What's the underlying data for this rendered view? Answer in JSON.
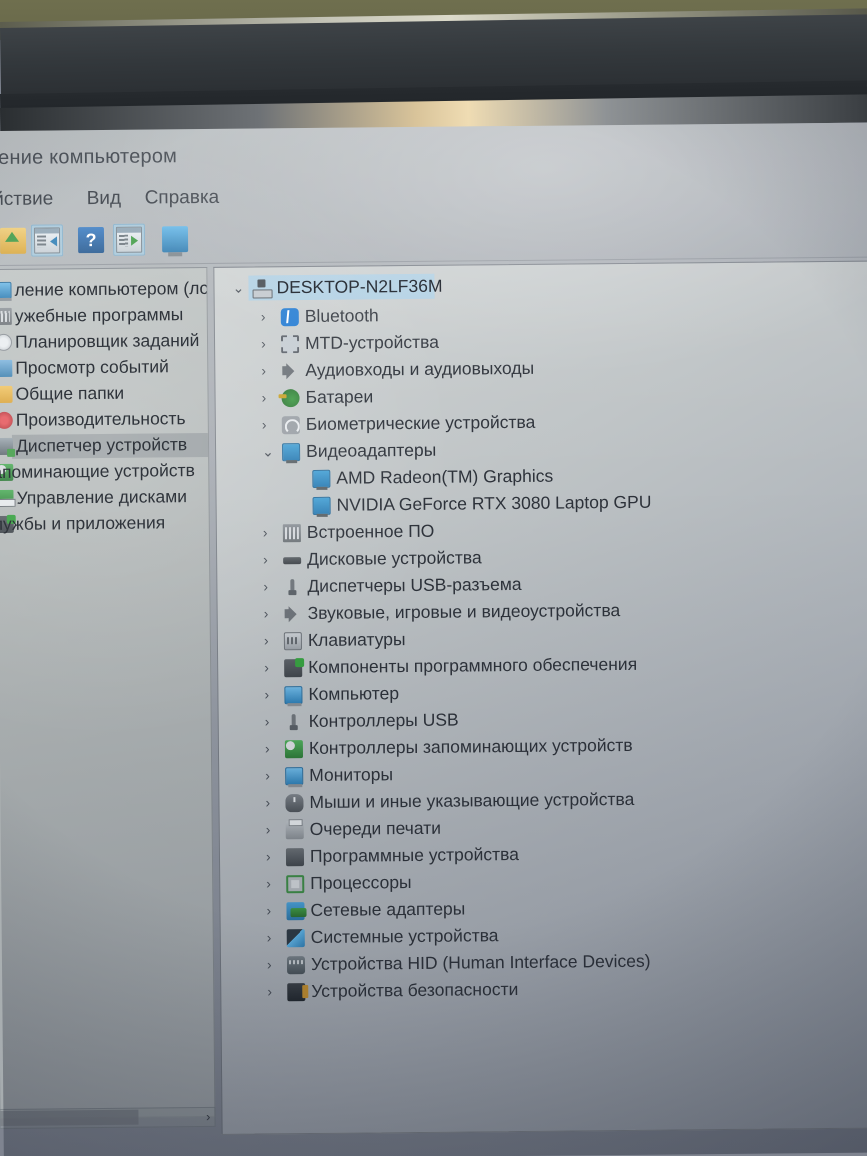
{
  "window": {
    "title": "ление компьютером",
    "title_full": "Управление компьютером"
  },
  "menubar": {
    "items": [
      {
        "label": "ействие",
        "name": "menu-action"
      },
      {
        "label": "Вид",
        "name": "menu-view"
      },
      {
        "label": "Справка",
        "name": "menu-help"
      }
    ]
  },
  "toolbar": {
    "buttons": [
      {
        "icon": "back-folder-icon",
        "selected": false
      },
      {
        "icon": "show-hide-console-tree-icon",
        "selected": true
      },
      {
        "icon": "help-icon",
        "selected": false
      },
      {
        "icon": "show-hide-action-pane-icon",
        "selected": true
      },
      {
        "icon": "computer-monitor-icon",
        "selected": false
      }
    ]
  },
  "sidebar": {
    "items": [
      {
        "label": "ление компьютером (лс",
        "icon": "computer-icon",
        "selected": false,
        "indent": 0
      },
      {
        "label": "ужебные программы",
        "icon": "tools-icon",
        "selected": false,
        "indent": 0
      },
      {
        "label": "Планировщик заданий",
        "icon": "clock-icon",
        "selected": false,
        "indent": 1
      },
      {
        "label": "Просмотр событий",
        "icon": "event-viewer-icon",
        "selected": false,
        "indent": 1
      },
      {
        "label": "Общие папки",
        "icon": "folder-icon",
        "selected": false,
        "indent": 1
      },
      {
        "label": "Производительность",
        "icon": "performance-icon",
        "selected": false,
        "indent": 1
      },
      {
        "label": "Диспетчер устройств",
        "icon": "device-manager-icon",
        "selected": true,
        "indent": 1
      },
      {
        "label": "апоминающие устройств",
        "icon": "storage-icon",
        "selected": false,
        "indent": 0
      },
      {
        "label": "Управление дисками",
        "icon": "disk-management-icon",
        "selected": false,
        "indent": 1
      },
      {
        "label": "лужбы и приложения",
        "icon": "services-icon",
        "selected": false,
        "indent": 0
      }
    ]
  },
  "device_tree": {
    "root": {
      "label": "DESKTOP-N2LF36M",
      "icon": "computer-host-icon",
      "expanded": true,
      "selected": true
    },
    "nodes": [
      {
        "label": "Bluetooth",
        "icon": "bluetooth-icon",
        "iconclass": "ic-bt",
        "depth": 1,
        "expanded": false
      },
      {
        "label": "MTD-устройства",
        "icon": "mtd-device-icon",
        "iconclass": "ic-mtd",
        "depth": 1,
        "expanded": false
      },
      {
        "label": "Аудиовходы и аудиовыходы",
        "icon": "speaker-icon",
        "iconclass": "ic-spk",
        "depth": 1,
        "expanded": false
      },
      {
        "label": "Батареи",
        "icon": "battery-icon",
        "iconclass": "ic-bat",
        "depth": 1,
        "expanded": false
      },
      {
        "label": "Биометрические устройства",
        "icon": "fingerprint-icon",
        "iconclass": "ic-bio",
        "depth": 1,
        "expanded": false
      },
      {
        "label": "Видеоадаптеры",
        "icon": "display-adapter-icon",
        "iconclass": "ic-mon",
        "depth": 1,
        "expanded": true
      },
      {
        "label": "AMD Radeon(TM) Graphics",
        "icon": "display-adapter-icon",
        "iconclass": "ic-mon",
        "depth": 2,
        "expanded": null
      },
      {
        "label": "NVIDIA GeForce RTX 3080 Laptop GPU",
        "icon": "display-adapter-icon",
        "iconclass": "ic-mon",
        "depth": 2,
        "expanded": null
      },
      {
        "label": "Встроенное ПО",
        "icon": "firmware-icon",
        "iconclass": "ic-fw",
        "depth": 1,
        "expanded": false
      },
      {
        "label": "Дисковые устройства",
        "icon": "disk-drive-icon",
        "iconclass": "ic-disk",
        "depth": 1,
        "expanded": false
      },
      {
        "label": "Диспетчеры USB-разъема",
        "icon": "usb-connector-icon",
        "iconclass": "ic-usb",
        "depth": 1,
        "expanded": false
      },
      {
        "label": "Звуковые, игровые и видеоустройства",
        "icon": "speaker-icon",
        "iconclass": "ic-spk",
        "depth": 1,
        "expanded": false
      },
      {
        "label": "Клавиатуры",
        "icon": "keyboard-icon",
        "iconclass": "ic-kb",
        "depth": 1,
        "expanded": false
      },
      {
        "label": "Компоненты программного обеспечения",
        "icon": "software-component-icon",
        "iconclass": "ic-sw",
        "depth": 1,
        "expanded": false
      },
      {
        "label": "Компьютер",
        "icon": "computer-icon",
        "iconclass": "ic-pc",
        "depth": 1,
        "expanded": false
      },
      {
        "label": "Контроллеры USB",
        "icon": "usb-controller-icon",
        "iconclass": "ic-usb",
        "depth": 1,
        "expanded": false
      },
      {
        "label": "Контроллеры запоминающих устройств",
        "icon": "storage-controller-icon",
        "iconclass": "ic-store",
        "depth": 1,
        "expanded": false
      },
      {
        "label": "Мониторы",
        "icon": "monitor-icon",
        "iconclass": "ic-pc",
        "depth": 1,
        "expanded": false
      },
      {
        "label": "Мыши и иные указывающие устройства",
        "icon": "mouse-icon",
        "iconclass": "ic-mouse",
        "depth": 1,
        "expanded": false
      },
      {
        "label": "Очереди печати",
        "icon": "printer-icon",
        "iconclass": "ic-print",
        "depth": 1,
        "expanded": false
      },
      {
        "label": "Программные устройства",
        "icon": "software-device-icon",
        "iconclass": "ic-soft",
        "depth": 1,
        "expanded": false
      },
      {
        "label": "Процессоры",
        "icon": "processor-icon",
        "iconclass": "ic-cpu",
        "depth": 1,
        "expanded": false
      },
      {
        "label": "Сетевые адаптеры",
        "icon": "network-adapter-icon",
        "iconclass": "ic-net",
        "depth": 1,
        "expanded": false
      },
      {
        "label": "Системные устройства",
        "icon": "system-device-icon",
        "iconclass": "ic-sys",
        "depth": 1,
        "expanded": false
      },
      {
        "label": "Устройства HID (Human Interface Devices)",
        "icon": "hid-device-icon",
        "iconclass": "ic-hid",
        "depth": 1,
        "expanded": false
      },
      {
        "label": "Устройства безопасности",
        "icon": "security-device-icon",
        "iconclass": "ic-sec",
        "depth": 1,
        "expanded": false
      }
    ]
  },
  "glyphs": {
    "chevron_right": "›",
    "chevron_down": "⌄",
    "help_mark": "?",
    "scroll_right": "›"
  },
  "colors": {
    "selection_blue": "#a6cee8",
    "selection_grey": "#92989c",
    "screen_light": "#bfc4c3",
    "screen_dark": "#7b818d",
    "bezel": "#2b2f33",
    "wall": "#6b6b4c",
    "text": "#2d323a"
  }
}
